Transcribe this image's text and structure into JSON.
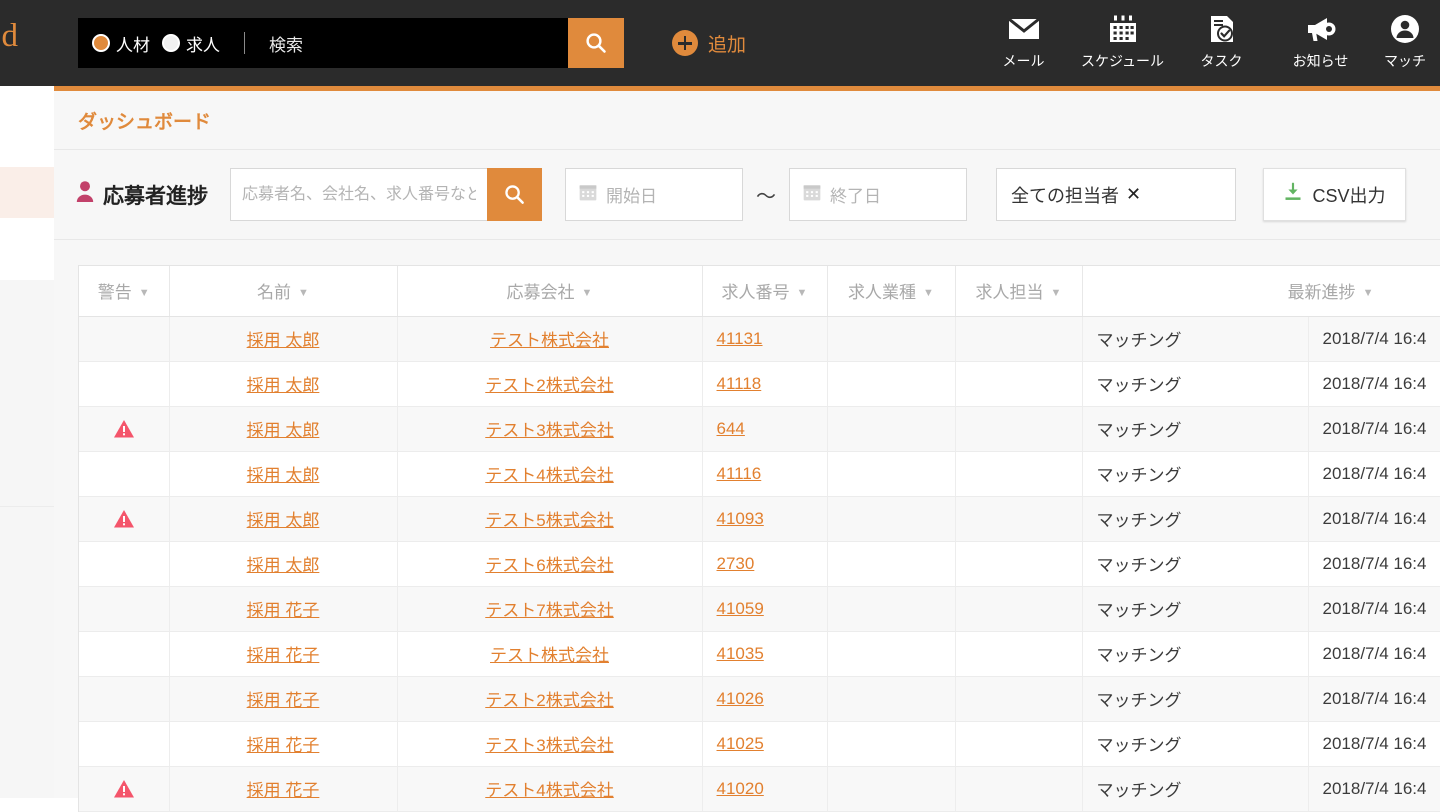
{
  "brand": {
    "text": "od"
  },
  "header": {
    "search": {
      "radios": [
        {
          "label": "人材",
          "selected": true
        },
        {
          "label": "求人",
          "selected": false
        }
      ],
      "placeholder": "検索",
      "button_icon": "search-icon"
    },
    "add": {
      "label": "追加",
      "icon": "plus-circle-icon"
    },
    "nav": [
      {
        "label": "メール",
        "icon": "mail-icon"
      },
      {
        "label": "スケジュール",
        "icon": "calendar-icon"
      },
      {
        "label": "タスク",
        "icon": "task-icon"
      },
      {
        "label": "お知らせ",
        "icon": "megaphone-icon"
      },
      {
        "label": "マッチ",
        "icon": "user-avatar-icon"
      }
    ]
  },
  "breadcrumb": {
    "label": "ダッシュボード"
  },
  "filters": {
    "section_title": "応募者進捗",
    "section_icon": "person-icon",
    "keyword_placeholder": "応募者名、会社名、求人番号など",
    "search_button_icon": "search-icon",
    "date_start_placeholder": "開始日",
    "date_end_placeholder": "終了日",
    "date_separator": "〜",
    "owner_select_value": "全ての担当者",
    "owner_clear_icon": "close-x-icon",
    "csv_button_label": "CSV出力",
    "csv_button_icon": "download-icon"
  },
  "table": {
    "columns": [
      {
        "label": "警告",
        "sortable": true
      },
      {
        "label": "名前",
        "sortable": true
      },
      {
        "label": "応募会社",
        "sortable": true
      },
      {
        "label": "求人番号",
        "sortable": true
      },
      {
        "label": "求人業種",
        "sortable": true
      },
      {
        "label": "求人担当",
        "sortable": true
      },
      {
        "label": "最新進捗",
        "sortable": true
      },
      {
        "label": "",
        "sortable": false
      }
    ],
    "rows": [
      {
        "warning": false,
        "name": "採用 太郎",
        "company": "テスト株式会社",
        "job_no": "41131",
        "industry": "",
        "owner": "",
        "progress": "マッチング",
        "date": "2018/7/4 16:4"
      },
      {
        "warning": false,
        "name": "採用 太郎",
        "company": "テスト2株式会社",
        "job_no": "41118",
        "industry": "",
        "owner": "",
        "progress": "マッチング",
        "date": "2018/7/4 16:4"
      },
      {
        "warning": true,
        "name": "採用 太郎",
        "company": "テスト3株式会社",
        "job_no": "644",
        "industry": "",
        "owner": "",
        "progress": "マッチング",
        "date": "2018/7/4 16:4"
      },
      {
        "warning": false,
        "name": "採用 太郎",
        "company": "テスト4株式会社",
        "job_no": "41116",
        "industry": "",
        "owner": "",
        "progress": "マッチング",
        "date": "2018/7/4 16:4"
      },
      {
        "warning": true,
        "name": "採用 太郎",
        "company": "テスト5株式会社",
        "job_no": "41093",
        "industry": "",
        "owner": "",
        "progress": "マッチング",
        "date": "2018/7/4 16:4"
      },
      {
        "warning": false,
        "name": "採用 太郎",
        "company": "テスト6株式会社",
        "job_no": "2730",
        "industry": "",
        "owner": "",
        "progress": "マッチング",
        "date": "2018/7/4 16:4"
      },
      {
        "warning": false,
        "name": "採用 花子",
        "company": "テスト7株式会社",
        "job_no": "41059",
        "industry": "",
        "owner": "",
        "progress": "マッチング",
        "date": "2018/7/4 16:4"
      },
      {
        "warning": false,
        "name": "採用 花子",
        "company": "テスト株式会社",
        "job_no": "41035",
        "industry": "",
        "owner": "",
        "progress": "マッチング",
        "date": "2018/7/4 16:4"
      },
      {
        "warning": false,
        "name": "採用 花子",
        "company": "テスト2株式会社",
        "job_no": "41026",
        "industry": "",
        "owner": "",
        "progress": "マッチング",
        "date": "2018/7/4 16:4"
      },
      {
        "warning": false,
        "name": "採用 花子",
        "company": "テスト3株式会社",
        "job_no": "41025",
        "industry": "",
        "owner": "",
        "progress": "マッチング",
        "date": "2018/7/4 16:4"
      },
      {
        "warning": true,
        "name": "採用 花子",
        "company": "テスト4株式会社",
        "job_no": "41020",
        "industry": "",
        "owner": "",
        "progress": "マッチング",
        "date": "2018/7/4 16:4"
      }
    ]
  },
  "colors": {
    "accent_orange": "#e08a3c",
    "link_orange": "#e2802f",
    "header_dark": "#2b2b2b",
    "warning_red": "#f4556b",
    "person_icon_crimson": "#c2416a",
    "csv_green": "#62b462"
  }
}
